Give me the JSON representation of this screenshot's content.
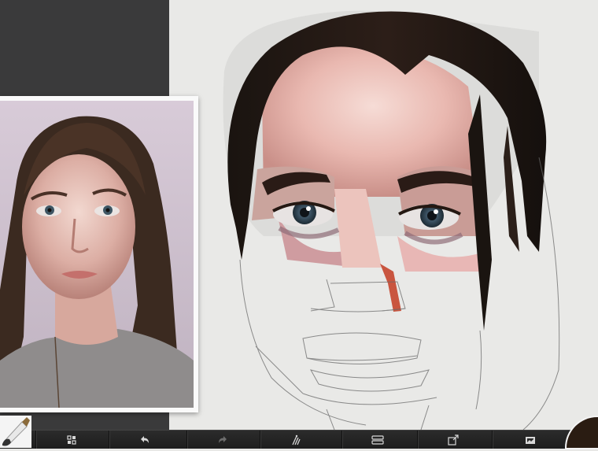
{
  "app": {
    "colors": {
      "panel": "#3a3a3b",
      "canvas": "#e9e9e7",
      "toolbar": "#242424",
      "icon": "#d8d8d8",
      "current_color": "#2a1c12"
    }
  },
  "toolbar": {
    "items": [
      {
        "name": "transform",
        "icon": "transform-icon"
      },
      {
        "name": "undo",
        "icon": "undo-icon"
      },
      {
        "name": "redo",
        "icon": "redo-icon"
      },
      {
        "name": "brushes",
        "icon": "brush-select-icon"
      },
      {
        "name": "layers",
        "icon": "layers-icon"
      },
      {
        "name": "export",
        "icon": "export-icon"
      },
      {
        "name": "gallery",
        "icon": "gallery-icon"
      }
    ]
  }
}
